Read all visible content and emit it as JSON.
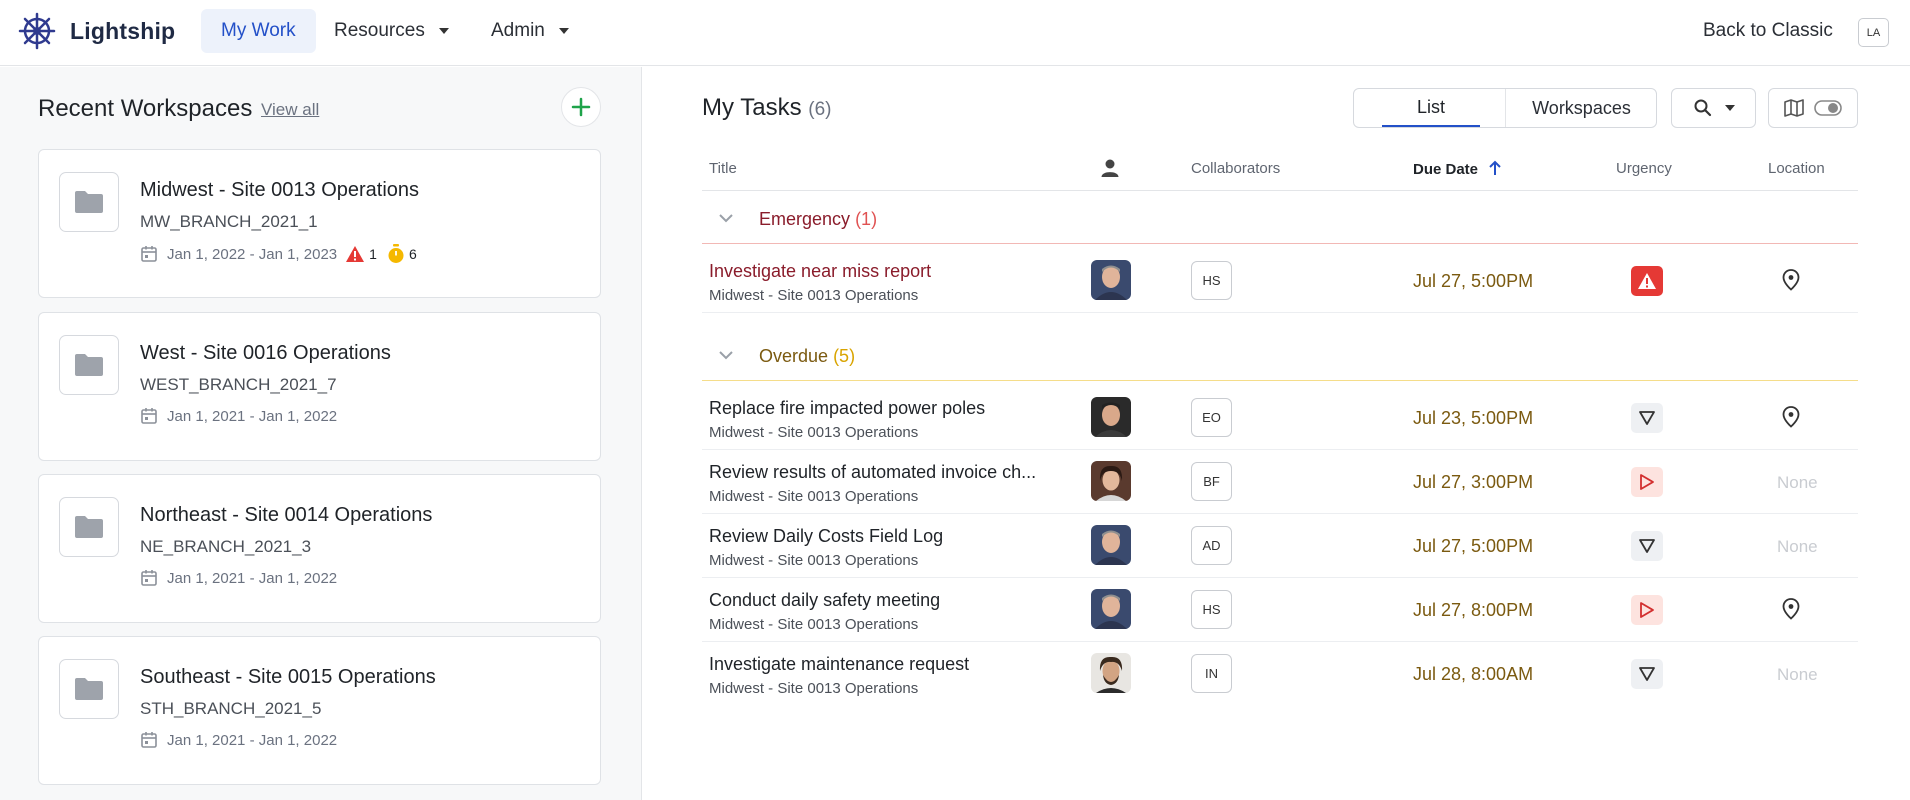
{
  "app": {
    "brand": "Lightship",
    "nav": [
      {
        "label": "My Work"
      },
      {
        "label": "Resources"
      },
      {
        "label": "Admin"
      }
    ],
    "back_to_classic": "Back to Classic",
    "user_initials": "LA"
  },
  "recent": {
    "title": "Recent Workspaces",
    "view_all": "View all",
    "workspaces": [
      {
        "name": "Midwest - Site 0013 Operations",
        "code": "MW_BRANCH_2021_1",
        "dates": "Jan 1, 2022 - Jan 1, 2023",
        "alerts": "1",
        "timers": "6"
      },
      {
        "name": "West - Site 0016 Operations",
        "code": "WEST_BRANCH_2021_7",
        "dates": "Jan 1, 2021 - Jan 1, 2022"
      },
      {
        "name": "Northeast - Site 0014 Operations",
        "code": "NE_BRANCH_2021_3",
        "dates": "Jan 1, 2021 - Jan 1, 2022"
      },
      {
        "name": "Southeast - Site 0015 Operations",
        "code": "STH_BRANCH_2021_5",
        "dates": "Jan 1, 2021 - Jan 1, 2022"
      }
    ]
  },
  "tasks": {
    "title": "My Tasks",
    "count": "(6)",
    "view_toggle": {
      "list": "List",
      "workspaces": "Workspaces"
    },
    "columns": {
      "title": "Title",
      "collaborators": "Collaborators",
      "due_date": "Due Date",
      "urgency": "Urgency",
      "location": "Location"
    },
    "groups": [
      {
        "label": "Emergency",
        "count": "(1)",
        "color": "#8a1c2b",
        "line": "#f2b8b5"
      },
      {
        "label": "Overdue",
        "count": "(5)",
        "color": "#7b5a10",
        "line": "#f5dd8a"
      }
    ],
    "rows": [
      {
        "title": "Investigate near miss report",
        "workspace": "Midwest - Site 0013 Operations",
        "collab": "HS",
        "due": "Jul 27, 5:00PM",
        "urgency": "emergency",
        "location": "pin"
      },
      {
        "title": "Replace fire impacted power poles",
        "workspace": "Midwest - Site 0013 Operations",
        "collab": "EO",
        "due": "Jul 23, 5:00PM",
        "urgency": "low",
        "location": "pin"
      },
      {
        "title": "Review results of automated invoice ch...",
        "workspace": "Midwest - Site 0013 Operations",
        "collab": "BF",
        "due": "Jul 27, 3:00PM",
        "urgency": "high",
        "location": "None"
      },
      {
        "title": "Review Daily Costs Field Log",
        "workspace": "Midwest - Site 0013 Operations",
        "collab": "AD",
        "due": "Jul 27, 5:00PM",
        "urgency": "low",
        "location": "None"
      },
      {
        "title": "Conduct daily safety meeting",
        "workspace": "Midwest - Site 0013 Operations",
        "collab": "HS",
        "due": "Jul 27, 8:00PM",
        "urgency": "high",
        "location": "pin"
      },
      {
        "title": "Investigate maintenance request",
        "workspace": "Midwest - Site 0013 Operations",
        "collab": "IN",
        "due": "Jul 28, 8:00AM",
        "urgency": "low",
        "location": "None"
      }
    ]
  }
}
